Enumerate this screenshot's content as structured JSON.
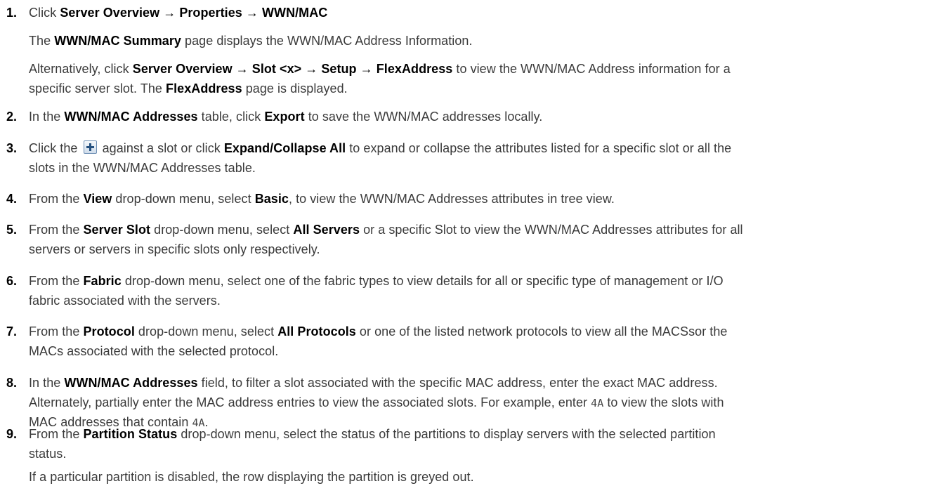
{
  "steps": [
    {
      "num": "1.",
      "text": "Click ",
      "b1": "Server Overview → Properties → WWN/MAC"
    },
    {
      "num": "2.",
      "t1": "In the ",
      "b1": "WWN/MAC Addresses",
      "t2": " table, click ",
      "b2": "Export",
      "t3": " to save the WWN/MAC addresses locally."
    },
    {
      "num": "3.",
      "t1": "Click the ",
      "t2": " against a slot or click ",
      "b1": "Expand/Collapse All",
      "t3": " to expand or collapse the attributes listed for a specific slot or all the",
      "l2": "slots in the WWN/MAC Addresses table."
    },
    {
      "num": "4.",
      "t1": "From the ",
      "b1": "View",
      "t2": " drop-down menu, select ",
      "b2": "Basic",
      "t3": ", to view the WWN/MAC Addresses attributes in tree view."
    },
    {
      "num": "5.",
      "t1": "From the ",
      "b1": "Server Slot",
      "t2": " drop-down menu, select ",
      "b2": "All Servers",
      "t3": " or a specific Slot to view the WWN/MAC Addresses attributes for all",
      "l2": "servers or servers in specific slots only respectively."
    },
    {
      "num": "6.",
      "t1": "From the ",
      "b1": "Fabric",
      "t2": " drop-down menu, select one of the fabric types to view details for all or specific type of management or I/O",
      "l2": "fabric associated with the servers."
    },
    {
      "num": "7.",
      "t1": "From the ",
      "b1": "Protocol",
      "t2": " drop-down menu, select ",
      "b2": "All Protocols",
      "t3": " or one of the listed network protocols to view all the MACSsor the",
      "l2": "MACs associated with the selected protocol."
    },
    {
      "num": "8.",
      "t1": "In the ",
      "b1": "WWN/MAC Addresses",
      "t2": " field, to filter a slot associated with the specific MAC address, enter the exact MAC address.",
      "l2": "Alternately, partially enter the MAC address entries to view the associated slots. For example, enter ",
      "code1": "4A",
      "l2b": " to view the slots with",
      "l3": "MAC addresses that contain ",
      "code2": "4A",
      "l3b": "."
    },
    {
      "num": "9.",
      "t1": "From the ",
      "b1": "Partition Status",
      "t2": " drop-down menu, select the status of the partitions to display servers with the selected partition",
      "l2": "status."
    }
  ],
  "step1_sub": {
    "p1a": "The ",
    "p1b": "WWN/MAC Summary",
    "p1c": " page displays the WWN/MAC Address Information.",
    "p2a": "Alternatively, click ",
    "p2b": "Server Overview → Slot <x> → Setup → FlexAddress",
    "p2c": " to view the WWN/MAC Address information for a",
    "p3a": "specific server slot. The ",
    "p3b": "FlexAddress",
    "p3c": " page is displayed."
  },
  "step9_note": "If a particular partition is disabled, the row displaying the partition is greyed out."
}
